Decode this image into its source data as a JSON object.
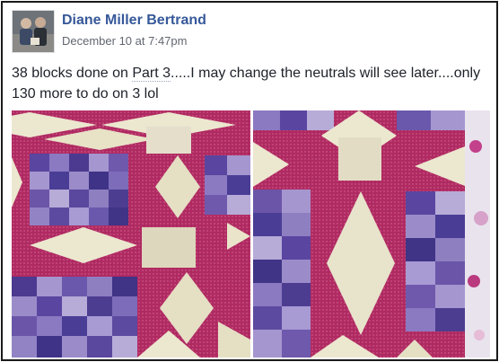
{
  "post": {
    "author": "Diane Miller Bertrand",
    "timestamp": "December 10 at 7:47pm",
    "text_before_link": "38 blocks done on ",
    "link_text": "Part 3",
    "text_after_link": ".....I may change the neutrals will see later....only 130 more to do on 3 lol"
  },
  "icons": {
    "avatar": "profile-photo",
    "photo_left": "quilt-blocks-photo-left",
    "photo_right": "quilt-blocks-photo-right"
  },
  "colors": {
    "author_link": "#365899",
    "timestamp": "#616770",
    "quilt_magenta": "#b3245f",
    "quilt_purple": "#5b3f9a",
    "quilt_cream": "#ebe6cc"
  }
}
